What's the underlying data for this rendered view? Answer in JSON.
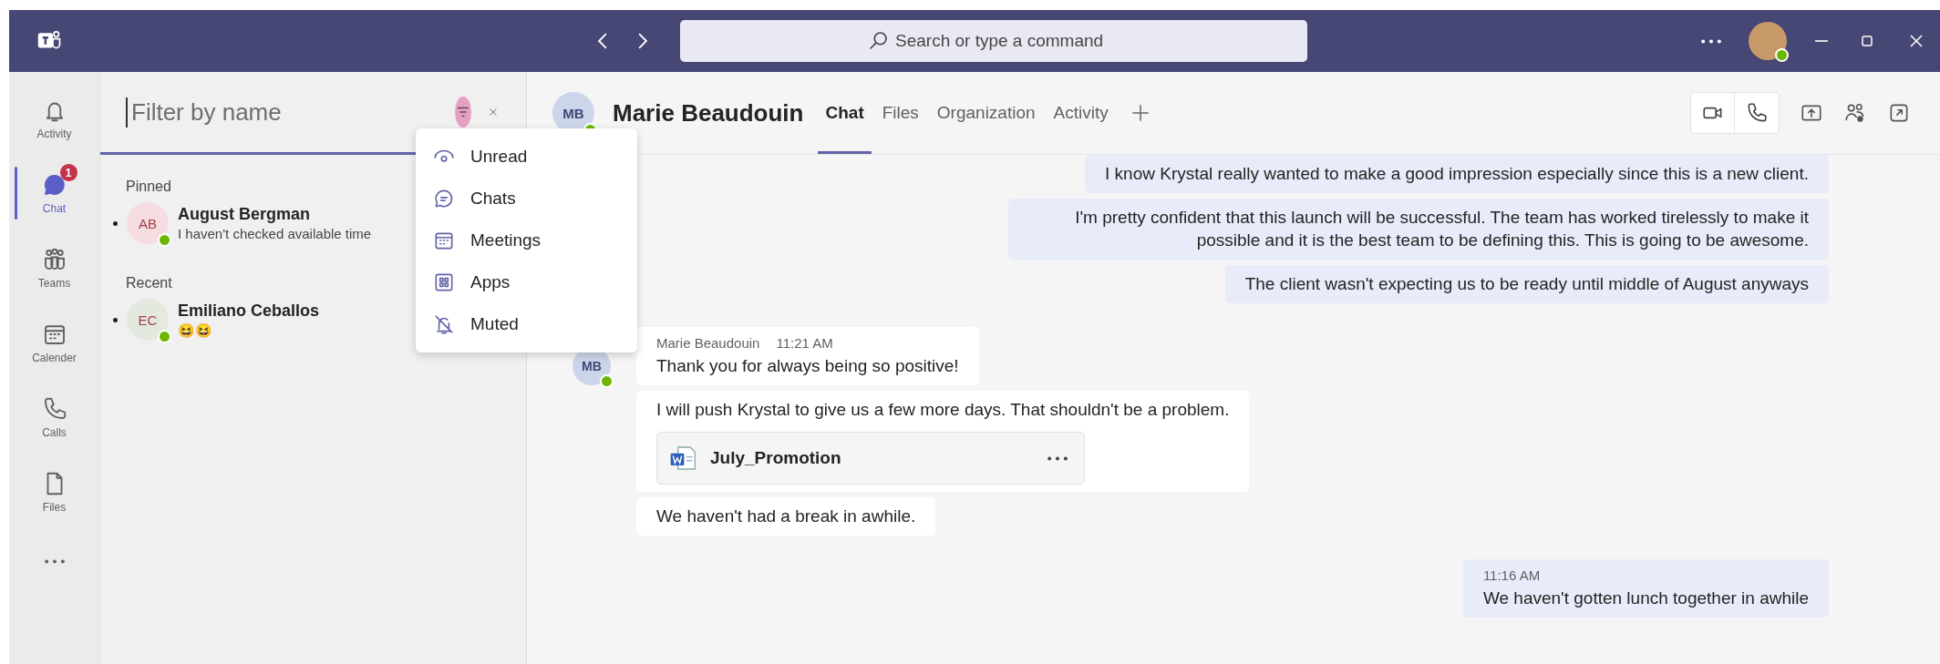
{
  "title_bar": {
    "search_placeholder": "Search or type a command"
  },
  "rail": [
    {
      "label": "Activity",
      "selected": false
    },
    {
      "label": "Chat",
      "selected": true,
      "badge": "1"
    },
    {
      "label": "Teams",
      "selected": false
    },
    {
      "label": "Calender",
      "selected": false
    },
    {
      "label": "Calls",
      "selected": false
    },
    {
      "label": "Files",
      "selected": false
    },
    {
      "selected": false
    }
  ],
  "chat_list": {
    "filter_placeholder": "Filter by name",
    "sections": [
      {
        "title": "Pinned",
        "items": [
          {
            "initials": "AB",
            "color": "#f6dde2",
            "name": "August Bergman",
            "preview": "I haven't checked available time"
          }
        ]
      },
      {
        "title": "Recent",
        "items": [
          {
            "initials": "EC",
            "color": "#e3e9de",
            "name": "Emiliano Ceballos",
            "preview": "😆😆"
          }
        ]
      }
    ]
  },
  "filter_menu": [
    {
      "label": "Unread"
    },
    {
      "label": "Chats"
    },
    {
      "label": "Meetings"
    },
    {
      "label": "Apps"
    },
    {
      "label": "Muted"
    }
  ],
  "conversation": {
    "header": {
      "initials": "MB",
      "name": "Marie Beaudouin",
      "tabs": [
        {
          "label": "Chat",
          "selected": true
        },
        {
          "label": "Files",
          "selected": false
        },
        {
          "label": "Organization",
          "selected": false
        },
        {
          "label": "Activity",
          "selected": false
        }
      ]
    },
    "messages": [
      {
        "kind": "outgoing",
        "text": "I know Krystal really wanted to make a good impression especially since this is a new client."
      },
      {
        "kind": "outgoing",
        "text": "I'm pretty confident that this launch will be successful. The team has worked tirelessly to make it possible and it is the best team to be defining this. This is going to be awesome."
      },
      {
        "kind": "outgoing",
        "text": "The client wasn't expecting us to be ready until middle of August anyways"
      },
      {
        "kind": "incoming",
        "initials": "MB",
        "author": "Marie Beaudouin",
        "time": "11:21 AM",
        "text": "Thank you for always being so positive!"
      },
      {
        "kind": "incoming",
        "text": "I will push Krystal to give us a few more days. That shouldn't be a problem.",
        "attachment": "July_Promotion"
      },
      {
        "kind": "incoming",
        "text": "We haven't had a break in awhile."
      },
      {
        "kind": "outgoing",
        "time": "11:16 AM",
        "text": "We haven't gotten lunch together in awhile"
      }
    ]
  }
}
